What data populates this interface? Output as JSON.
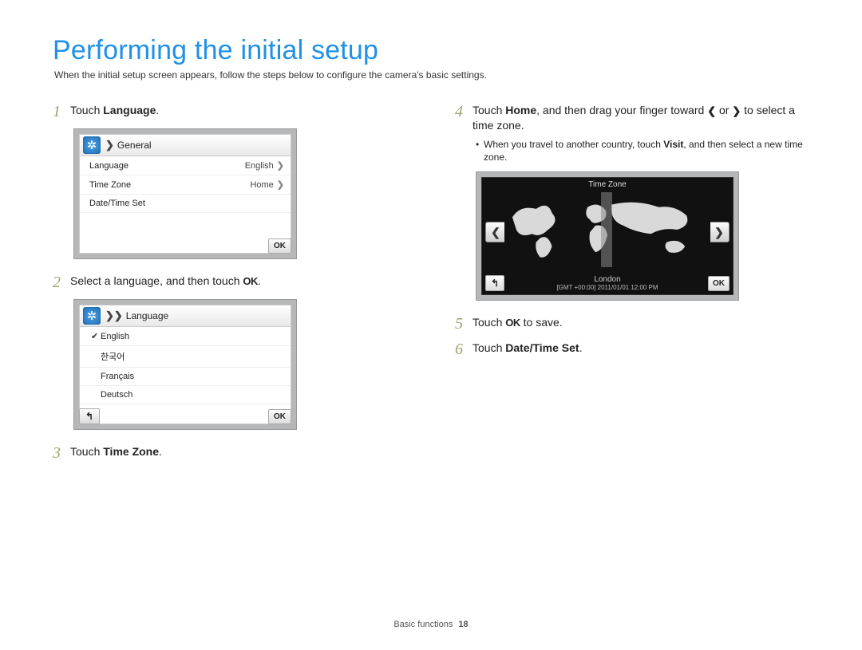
{
  "title": "Performing the initial setup",
  "intro": "When the initial setup screen appears, follow the steps below to configure the camera's basic settings.",
  "okGlyph": "OK",
  "steps": {
    "s1": {
      "num": "1",
      "pre": "Touch ",
      "bold": "Language",
      "post": "."
    },
    "s2": {
      "num": "2",
      "pre": "Select a language, and then touch ",
      "post": "."
    },
    "s3": {
      "num": "3",
      "pre": "Touch ",
      "bold": "Time Zone",
      "post": "."
    },
    "s4": {
      "num": "4",
      "pre": "Touch ",
      "bold": "Home",
      "mid": ", and then drag your finger toward ",
      "or": " or ",
      "post2": " to select a time zone."
    },
    "s4bullet": {
      "pre": "When you travel to another country, touch ",
      "bold": "Visit",
      "post": ", and then select a new time zone."
    },
    "s5": {
      "num": "5",
      "pre": "Touch ",
      "post": " to save."
    },
    "s6": {
      "num": "6",
      "pre": "Touch ",
      "bold": "Date/Time Set",
      "post": "."
    }
  },
  "screenGeneral": {
    "header": "General",
    "rows": [
      {
        "label": "Language",
        "value": "English"
      },
      {
        "label": "Time Zone",
        "value": "Home"
      },
      {
        "label": "Date/Time Set",
        "value": ""
      }
    ],
    "ok": "OK"
  },
  "screenLanguage": {
    "header": "Language",
    "items": [
      "English",
      "한국어",
      "Français",
      "Deutsch"
    ],
    "selectedIndex": 0,
    "ok": "OK",
    "back": "↰"
  },
  "screenTimezone": {
    "title": "Time Zone",
    "city": "London",
    "gmt": "[GMT +00:00]  2011/01/01  12:00 PM",
    "ok": "OK",
    "back": "↰"
  },
  "chevLeft": "❮",
  "chevRight": "❯",
  "footer": {
    "section": "Basic functions",
    "page": "18"
  }
}
